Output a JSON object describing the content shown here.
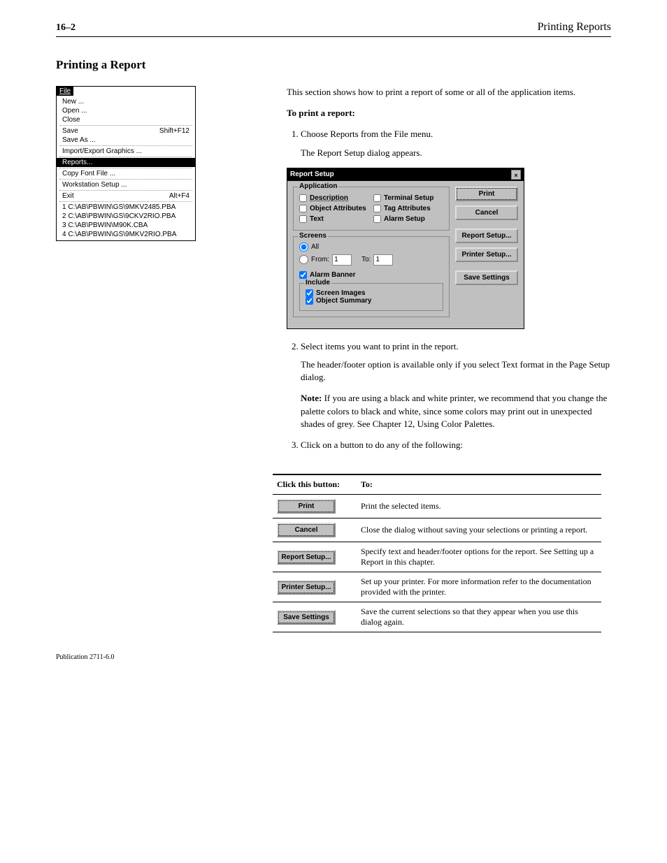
{
  "header": {
    "page_number": "16–2",
    "chapter": "Printing Reports"
  },
  "section_title": "Printing a Report",
  "intro": "This section shows how to print a report of some or all of the application items.",
  "to_print": "To print a report:",
  "steps": {
    "s1": "Choose Reports from the File menu.",
    "s1_after": "The Report Setup dialog appears.",
    "s2": "Select items you want to print in the report.",
    "s3": "Click on a button to do any of the following:"
  },
  "file_menu": {
    "menubar": "File",
    "new": "New ...",
    "open": "Open ...",
    "close": "Close",
    "save": "Save",
    "save_shortcut": "Shift+F12",
    "save_as": "Save As ...",
    "impexp": "Import/Export Graphics ...",
    "reports": "Reports...",
    "copyfont": "Copy Font File ...",
    "workstation": "Workstation Setup ...",
    "exit": "Exit",
    "exit_shortcut": "Alt+F4",
    "recent": [
      "1 C:\\AB\\PBWIN\\GS\\9MKV2485.PBA",
      "2 C:\\AB\\PBWIN\\GS\\9CKV2RIO.PBA",
      "3 C:\\AB\\PBWIN\\M90K.CBA",
      "4 C:\\AB\\PBWIN\\GS\\9MKV2RIO.PBA"
    ]
  },
  "dialog": {
    "title": "Report Setup",
    "application_group": "Application",
    "description": "Description",
    "object_attributes": "Object Attributes",
    "text": "Text",
    "terminal_setup": "Terminal Setup",
    "tag_attributes": "Tag Attributes",
    "alarm_setup": "Alarm Setup",
    "screens_group": "Screens",
    "all": "All",
    "from": "From:",
    "from_value": "1",
    "to": "To:",
    "to_value": "1",
    "alarm_banner": "Alarm Banner",
    "include_group": "Include",
    "screen_images": "Screen Images",
    "object_summary": "Object Summary",
    "buttons": {
      "print": "Print",
      "cancel": "Cancel",
      "report_setup": "Report Setup...",
      "printer_setup": "Printer Setup...",
      "save_settings": "Save Settings"
    }
  },
  "notes": {
    "note1": "The header/footer option is available only if you select Text format in the Page Setup dialog.",
    "note2_prefix": "Note:",
    "note2": "If you are using a black and white printer, we recommend that you change the palette colors to black and white, since some colors may print out in unexpected shades of grey. See Chapter 12, Using Color Palettes.",
    "button_table_intro_header": "Click this button:",
    "button_table_intro_desc": "To:"
  },
  "button_table": [
    {
      "btn": "Print",
      "desc": "Print the selected items."
    },
    {
      "btn": "Cancel",
      "desc": "Close the dialog without saving your selections or printing a report."
    },
    {
      "btn": "Report Setup...",
      "desc": "Specify text and header/footer options for the report. See Setting up a Report in this chapter."
    },
    {
      "btn": "Printer Setup...",
      "desc": "Set up your printer. For more information refer to the documentation provided with the printer."
    },
    {
      "btn": "Save Settings",
      "desc": "Save the current selections so that they appear when you use this dialog again."
    }
  ],
  "footer": "Publication 2711-6.0"
}
